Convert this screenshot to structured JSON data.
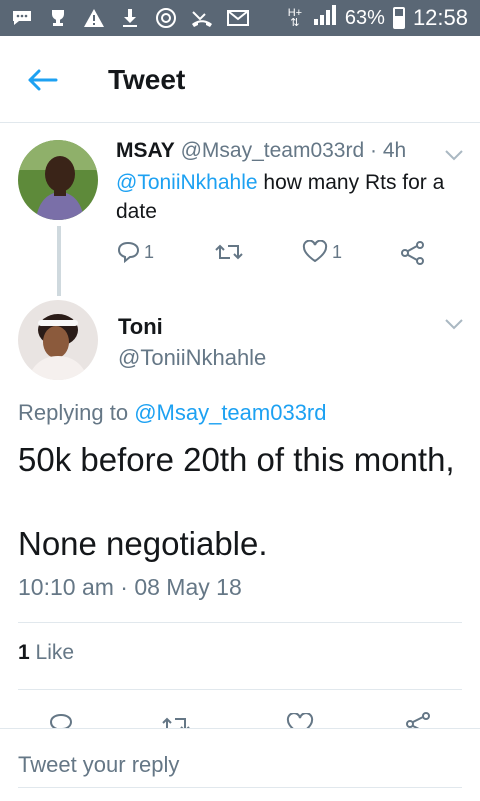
{
  "status_bar": {
    "network": "H+",
    "battery": "63%",
    "battery_level": 0.63,
    "time": "12:58"
  },
  "header": {
    "title": "Tweet"
  },
  "parent_tweet": {
    "display_name": "MSAY",
    "handle": "@Msay_team033rd",
    "separator": "·",
    "age": "4h",
    "mention": "@ToniiNkhahle",
    "text": " how many Rts for a date",
    "reply_count": "1",
    "like_count": "1"
  },
  "main_tweet": {
    "display_name": "Toni",
    "handle": "@ToniiNkhahle",
    "replying_prefix": "Replying to ",
    "replying_handle": "@Msay_team033rd",
    "body_line1": "50k before 20th of this month,",
    "body_line2": "None negotiable.",
    "timestamp": "10:10 am · 08 May 18",
    "like_count": "1",
    "like_label": " Like"
  },
  "reply_box": {
    "placeholder": "Tweet your reply"
  },
  "colors": {
    "accent": "#1da1f2",
    "status_bar": "#5a6775",
    "muted": "#657786"
  }
}
